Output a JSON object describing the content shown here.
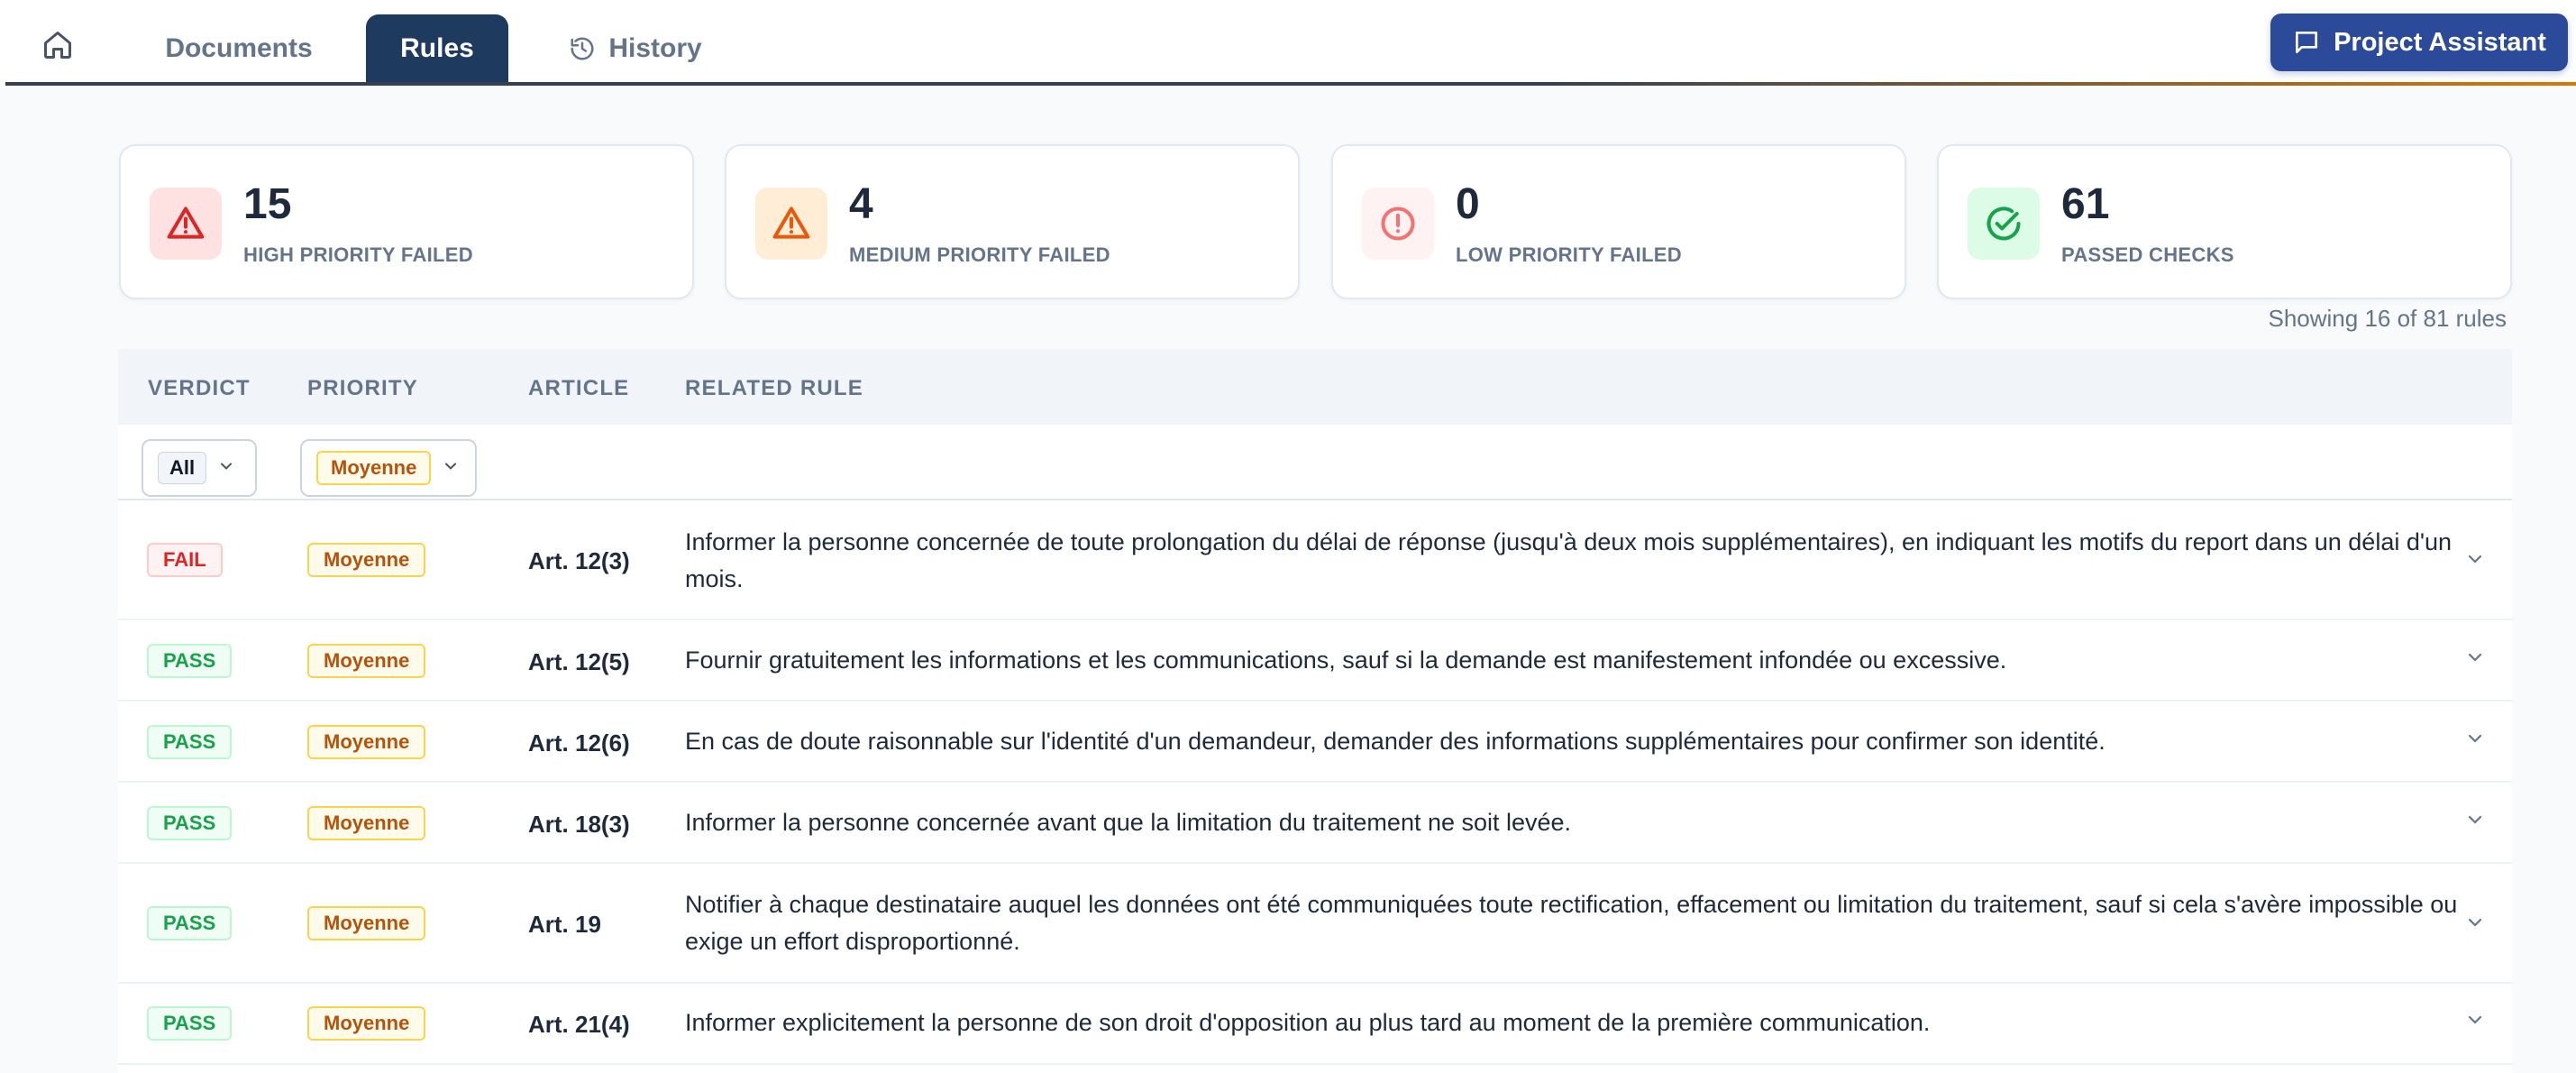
{
  "nav": {
    "tabs": [
      {
        "label": "Documents"
      },
      {
        "label": "Rules"
      },
      {
        "label": "History"
      }
    ],
    "assistant_label": "Project Assistant"
  },
  "stats": [
    {
      "count": "15",
      "label": "HIGH PRIORITY FAILED",
      "icon": "warning-triangle-icon",
      "color": "#dc2626",
      "bg": "#fee2e2"
    },
    {
      "count": "4",
      "label": "MEDIUM PRIORITY FAILED",
      "icon": "warning-triangle-icon",
      "color": "#ea580c",
      "bg": "#ffedd5"
    },
    {
      "count": "0",
      "label": "LOW PRIORITY FAILED",
      "icon": "alert-circle-icon",
      "color": "#f87171",
      "bg": "#fef2f2"
    },
    {
      "count": "61",
      "label": "PASSED CHECKS",
      "icon": "check-circle-icon",
      "color": "#16a34a",
      "bg": "#dcfce7"
    }
  ],
  "showing": "Showing 16 of 81 rules",
  "table": {
    "headers": [
      "VERDICT",
      "PRIORITY",
      "ARTICLE",
      "RELATED RULE"
    ],
    "filters": {
      "verdict": "All",
      "priority": "Moyenne"
    },
    "rows": [
      {
        "verdict": "FAIL",
        "priority": "Moyenne",
        "article": "Art. 12(3)",
        "rule": "Informer la personne concernée de toute prolongation du délai de réponse (jusqu'à deux mois supplémentaires), en indiquant les motifs du report dans un délai d'un mois."
      },
      {
        "verdict": "PASS",
        "priority": "Moyenne",
        "article": "Art. 12(5)",
        "rule": "Fournir gratuitement les informations et les communications, sauf si la demande est manifestement infondée ou excessive."
      },
      {
        "verdict": "PASS",
        "priority": "Moyenne",
        "article": "Art. 12(6)",
        "rule": "En cas de doute raisonnable sur l'identité d'un demandeur, demander des informations supplémentaires pour confirmer son identité."
      },
      {
        "verdict": "PASS",
        "priority": "Moyenne",
        "article": "Art. 18(3)",
        "rule": "Informer la personne concernée avant que la limitation du traitement ne soit levée."
      },
      {
        "verdict": "PASS",
        "priority": "Moyenne",
        "article": "Art. 19",
        "rule": "Notifier à chaque destinataire auquel les données ont été communiquées toute rectification, effacement ou limitation du traitement, sauf si cela s'avère impossible ou exige un effort disproportionné."
      },
      {
        "verdict": "PASS",
        "priority": "Moyenne",
        "article": "Art. 21(4)",
        "rule": "Informer explicitement la personne de son droit d'opposition au plus tard au moment de la première communication."
      }
    ]
  }
}
